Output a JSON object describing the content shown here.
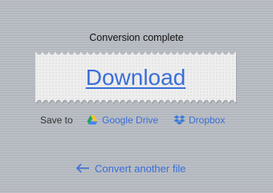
{
  "status_text": "Conversion complete",
  "download": {
    "label": "Download"
  },
  "save": {
    "label": "Save to",
    "google_drive": "Google Drive",
    "dropbox": "Dropbox"
  },
  "convert_another": "Convert another file",
  "colors": {
    "link": "#3a6fd8",
    "background": "#b8bcc3",
    "stamp": "#eeeeee"
  },
  "icons": [
    "google-drive-icon",
    "dropbox-icon",
    "arrow-left-icon"
  ]
}
